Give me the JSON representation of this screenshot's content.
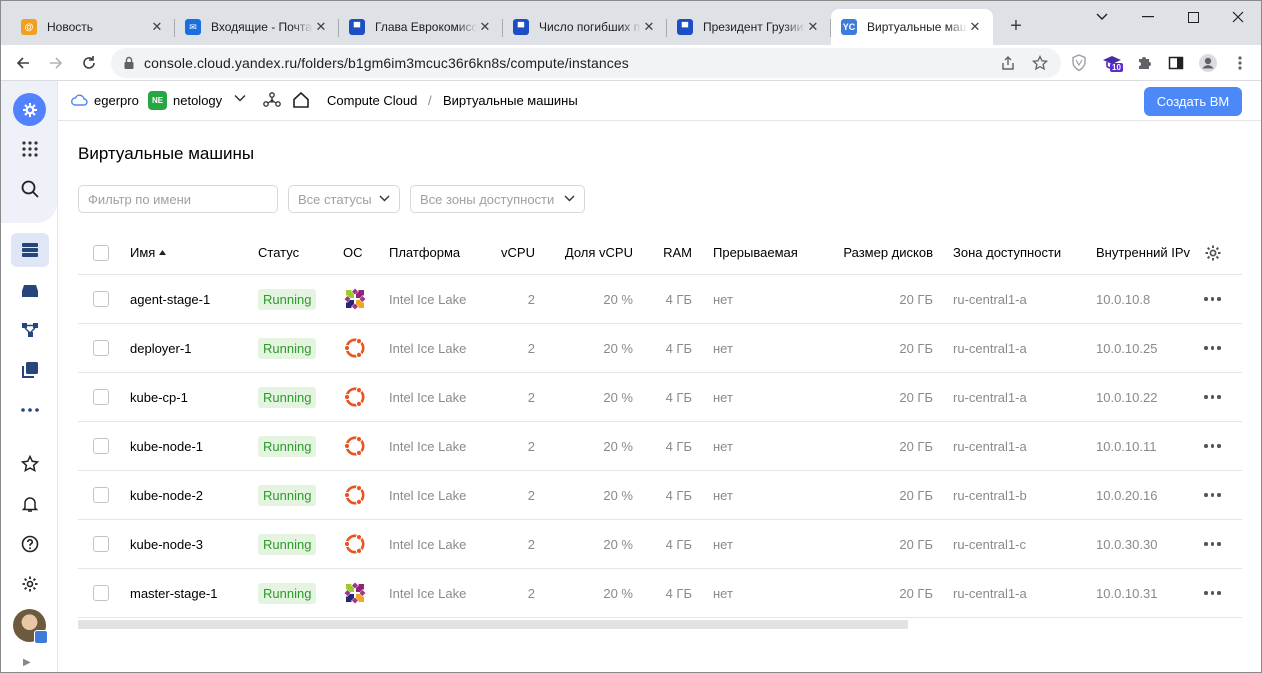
{
  "browser": {
    "tabs": [
      {
        "title": "Новость",
        "favicon": "mail-at-icon",
        "color": "#f0a020"
      },
      {
        "title": "Входящие - Почта",
        "favicon": "mail-envelope-icon",
        "color": "#1a6fe0"
      },
      {
        "title": "Глава Еврокомисс",
        "favicon": "news-icon",
        "color": "#1d4fc4"
      },
      {
        "title": "Число погибших п",
        "favicon": "news-icon",
        "color": "#1d4fc4"
      },
      {
        "title": "Президент Грузии",
        "favicon": "news-icon",
        "color": "#1d4fc4"
      },
      {
        "title": "Виртуальные маш",
        "favicon": "yc-icon",
        "color": "#3f7bd9",
        "favicon_text": "YC"
      }
    ],
    "url": "console.cloud.yandex.ru/folders/b1gm6im3mcuc36r6kn8s/compute/instances",
    "extension_badge": "10"
  },
  "header": {
    "org": "egerpro",
    "folder_badge": "NE",
    "folder": "netology",
    "breadcrumb_service": "Compute Cloud",
    "breadcrumb_sep": "/",
    "breadcrumb_page": "Виртуальные машины",
    "create_button": "Создать ВМ"
  },
  "page": {
    "title": "Виртуальные машины",
    "filter_placeholder": "Фильтр по имени",
    "status_select": "Все статусы",
    "zone_select": "Все зоны доступности"
  },
  "table": {
    "columns": {
      "name": "Имя",
      "status": "Статус",
      "os": "ОС",
      "platform": "Платформа",
      "vcpu": "vCPU",
      "vcpu_share": "Доля vCPU",
      "ram": "RAM",
      "preemptible": "Прерываемая",
      "disk_size": "Размер дисков",
      "zone": "Зона доступности",
      "internal_ip": "Внутренний IPv"
    },
    "rows": [
      {
        "name": "agent-stage-1",
        "status": "Running",
        "os": "centos-icon",
        "platform": "Intel Ice Lake",
        "vcpu": "2",
        "vcpu_share": "20 %",
        "ram": "4 ГБ",
        "preemptible": "нет",
        "disk_size": "20 ГБ",
        "zone": "ru-central1-a",
        "internal_ip": "10.0.10.8"
      },
      {
        "name": "deployer-1",
        "status": "Running",
        "os": "ubuntu-icon",
        "platform": "Intel Ice Lake",
        "vcpu": "2",
        "vcpu_share": "20 %",
        "ram": "4 ГБ",
        "preemptible": "нет",
        "disk_size": "20 ГБ",
        "zone": "ru-central1-a",
        "internal_ip": "10.0.10.25"
      },
      {
        "name": "kube-cp-1",
        "status": "Running",
        "os": "ubuntu-icon",
        "platform": "Intel Ice Lake",
        "vcpu": "2",
        "vcpu_share": "20 %",
        "ram": "4 ГБ",
        "preemptible": "нет",
        "disk_size": "20 ГБ",
        "zone": "ru-central1-a",
        "internal_ip": "10.0.10.22"
      },
      {
        "name": "kube-node-1",
        "status": "Running",
        "os": "ubuntu-icon",
        "platform": "Intel Ice Lake",
        "vcpu": "2",
        "vcpu_share": "20 %",
        "ram": "4 ГБ",
        "preemptible": "нет",
        "disk_size": "20 ГБ",
        "zone": "ru-central1-a",
        "internal_ip": "10.0.10.11"
      },
      {
        "name": "kube-node-2",
        "status": "Running",
        "os": "ubuntu-icon",
        "platform": "Intel Ice Lake",
        "vcpu": "2",
        "vcpu_share": "20 %",
        "ram": "4 ГБ",
        "preemptible": "нет",
        "disk_size": "20 ГБ",
        "zone": "ru-central1-b",
        "internal_ip": "10.0.20.16"
      },
      {
        "name": "kube-node-3",
        "status": "Running",
        "os": "ubuntu-icon",
        "platform": "Intel Ice Lake",
        "vcpu": "2",
        "vcpu_share": "20 %",
        "ram": "4 ГБ",
        "preemptible": "нет",
        "disk_size": "20 ГБ",
        "zone": "ru-central1-c",
        "internal_ip": "10.0.30.30"
      },
      {
        "name": "master-stage-1",
        "status": "Running",
        "os": "centos-icon",
        "platform": "Intel Ice Lake",
        "vcpu": "2",
        "vcpu_share": "20 %",
        "ram": "4 ГБ",
        "preemptible": "нет",
        "disk_size": "20 ГБ",
        "zone": "ru-central1-a",
        "internal_ip": "10.0.10.31"
      }
    ]
  },
  "colors": {
    "accent": "#4d88f8",
    "running_bg": "#e4f4e0",
    "running_text": "#2d9a2d",
    "ubuntu": "#e95420"
  }
}
